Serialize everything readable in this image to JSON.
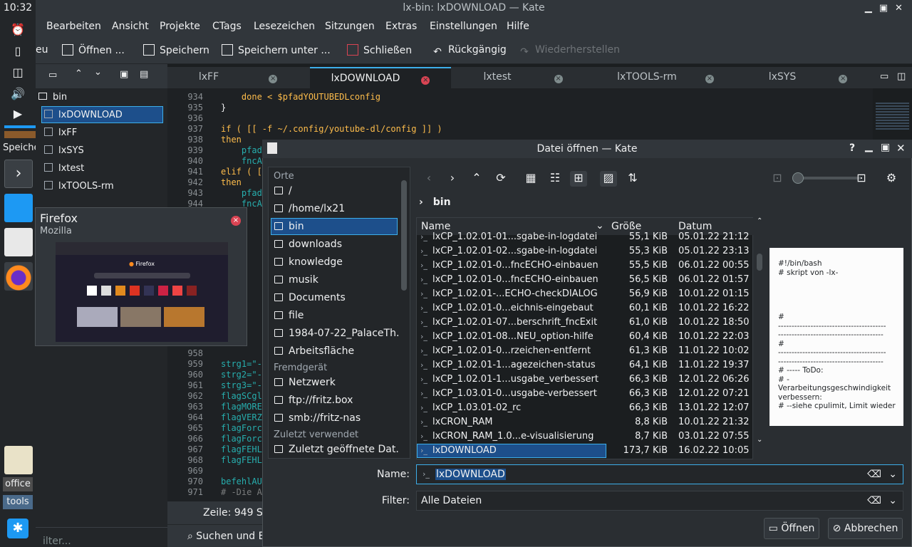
{
  "clock": "10:32",
  "dock": {
    "speicher_label": "Speiche",
    "office_label": "office",
    "tools_label": "tools"
  },
  "window_title": "lx-bin: lxDOWNLOAD — Kate",
  "menu": [
    "Bearbeiten",
    "Ansicht",
    "Projekte",
    "CTags",
    "Lesezeichen",
    "Sitzungen",
    "Extras",
    "Einstellungen",
    "Hilfe"
  ],
  "toolbar": {
    "neu": "eu",
    "open": "Öffnen ...",
    "save": "Speichern",
    "save_as": "Speichern unter ...",
    "close": "Schließen",
    "undo": "Rückgängig",
    "redo": "Wiederherstellen"
  },
  "sidebar": {
    "folder": "bin",
    "items": [
      "lxDOWNLOAD",
      "lxFF",
      "lxSYS",
      "lxtest",
      "lxTOOLS-rm"
    ],
    "filter_placeholder": "ilter..."
  },
  "tabs": [
    "lxFF",
    "lxDOWNLOAD",
    "lxtest",
    "lxTOOLS-rm",
    "lxSYS"
  ],
  "editor": {
    "lines": [
      {
        "n": "934",
        "t": "    done < $pfadYOUTUBEDLconfig"
      },
      {
        "n": "935",
        "t": "}"
      },
      {
        "n": "936",
        "t": ""
      },
      {
        "n": "937",
        "t": "if ( [[ -f ~/.config/youtube-dl/config ]] )"
      },
      {
        "n": "938",
        "t": "then"
      },
      {
        "n": "939",
        "t": "    pfad"
      },
      {
        "n": "940",
        "t": "    fncA"
      },
      {
        "n": "941",
        "t": "elif ( ["
      },
      {
        "n": "942",
        "t": "then"
      },
      {
        "n": "943",
        "t": "    pfad"
      },
      {
        "n": "944",
        "t": "    fncA"
      },
      {
        "n": "958",
        "t": ""
      },
      {
        "n": "959",
        "t": "strg1=\"-"
      },
      {
        "n": "960",
        "t": "strg2=\"-"
      },
      {
        "n": "961",
        "t": "strg3=\"-"
      },
      {
        "n": "962",
        "t": "flagSCgl"
      },
      {
        "n": "963",
        "t": "flagMORE"
      },
      {
        "n": "964",
        "t": "flagVERZ"
      },
      {
        "n": "965",
        "t": "flagForc"
      },
      {
        "n": "966",
        "t": "flagForc"
      },
      {
        "n": "967",
        "t": "flagFEHL"
      },
      {
        "n": "968",
        "t": "flagFEHL"
      },
      {
        "n": "969",
        "t": ""
      },
      {
        "n": "970",
        "t": "befehlAU"
      },
      {
        "n": "971",
        "t": "# -Die A"
      }
    ],
    "status": "Zeile: 949 Sp",
    "search": "Suchen und Erse"
  },
  "firefox_popup": {
    "title": "Firefox",
    "subtitle": "Mozilla",
    "thumb_title": "Firefox"
  },
  "dialog": {
    "title": "Datei öffnen — Kate",
    "breadcrumb": "bin",
    "places": {
      "header": "Orte",
      "items": [
        "/",
        "/home/lx21",
        "bin",
        "downloads",
        "knowledge",
        "musik",
        "Documents",
        "file",
        "1984-07-22_PalaceTh...",
        "Arbeitsfläche"
      ],
      "remote_header": "Fremdgerät",
      "remote": [
        "Netzwerk",
        "ftp://fritz.box",
        "smb://fritz-nas"
      ],
      "recent_header": "Zuletzt verwendet",
      "recent": [
        "Zuletzt geöffnete Dat..."
      ]
    },
    "columns": {
      "name": "Name",
      "size": "Größe",
      "date": "Datum"
    },
    "files": [
      {
        "name": "lxCP_1.02.01-01...sgabe-in-logdatei",
        "size": "55,1 KiB",
        "date": "05.01.22 21:12"
      },
      {
        "name": "lxCP_1.02.01-02...sgabe-in-logdatei",
        "size": "55,3 KiB",
        "date": "05.01.22 23:13"
      },
      {
        "name": "lxCP_1.02.01-0...fncECHO-einbauen",
        "size": "55,5 KiB",
        "date": "06.01.22 00:55"
      },
      {
        "name": "lxCP_1.02.01-0...fncECHO-einbauen",
        "size": "56,5 KiB",
        "date": "06.01.22 01:57"
      },
      {
        "name": "lxCP_1.02.01-...ECHO-checkDIALOG",
        "size": "56,9 KiB",
        "date": "10.01.22 01:15"
      },
      {
        "name": "lxCP_1.02.01-0...eichnis-eingebaut",
        "size": "60,1 KiB",
        "date": "10.01.22 16:22"
      },
      {
        "name": "lxCP_1.02.01-07...berschrift_fncExit",
        "size": "61,0 KiB",
        "date": "10.01.22 18:50"
      },
      {
        "name": "lxCP_1.02.01-08...NEU_option-hilfe",
        "size": "60,4 KiB",
        "date": "10.01.22 22:03"
      },
      {
        "name": "lxCP_1.02.01-0...rzeichen-entfernt",
        "size": "61,3 KiB",
        "date": "11.01.22 10:02"
      },
      {
        "name": "lxCP_1.02.01-1...agezeichen-status",
        "size": "64,1 KiB",
        "date": "11.01.22 19:37"
      },
      {
        "name": "lxCP_1.02.01-1...usgabe_verbessert",
        "size": "66,3 KiB",
        "date": "12.01.22 06:26"
      },
      {
        "name": "lxCP_1.03.01-0...usgabe-verbessert",
        "size": "66,3 KiB",
        "date": "12.01.22 07:21"
      },
      {
        "name": "lxCP_1.03.01-02_rc",
        "size": "66,3 KiB",
        "date": "13.01.22 12:07"
      },
      {
        "name": "lxCRON_RAM",
        "size": "8,8 KiB",
        "date": "10.01.22 21:32"
      },
      {
        "name": "lxCRON_RAM_1.0...e-visualisierung",
        "size": "8,7 KiB",
        "date": "03.01.22 07:55"
      },
      {
        "name": "lxDOWNLOAD",
        "size": "173,7 KiB",
        "date": "16.02.22 10:05"
      }
    ],
    "preview": [
      "#!/bin/bash",
      "# skript von -lx-",
      "",
      "",
      "",
      "",
      "#",
      "----------------------------------------",
      "---------------------------------------",
      "#",
      "----------------------------------------",
      "---------------------------------------",
      "# ----- ToDo:",
      "# -",
      "Verarbeitungsgeschwindigkeit",
      "verbessern:",
      "# --siehe cpulimit, Limit wieder"
    ],
    "name_label": "Name:",
    "name_value": "lxDOWNLOAD",
    "filter_label": "Filter:",
    "filter_value": "Alle Dateien",
    "open_button": "Öffnen",
    "cancel_button": "Abbrechen"
  },
  "colors": {
    "accent": "#2a5d9f",
    "selection": "#1d4f8b",
    "close_red": "#da4453"
  }
}
